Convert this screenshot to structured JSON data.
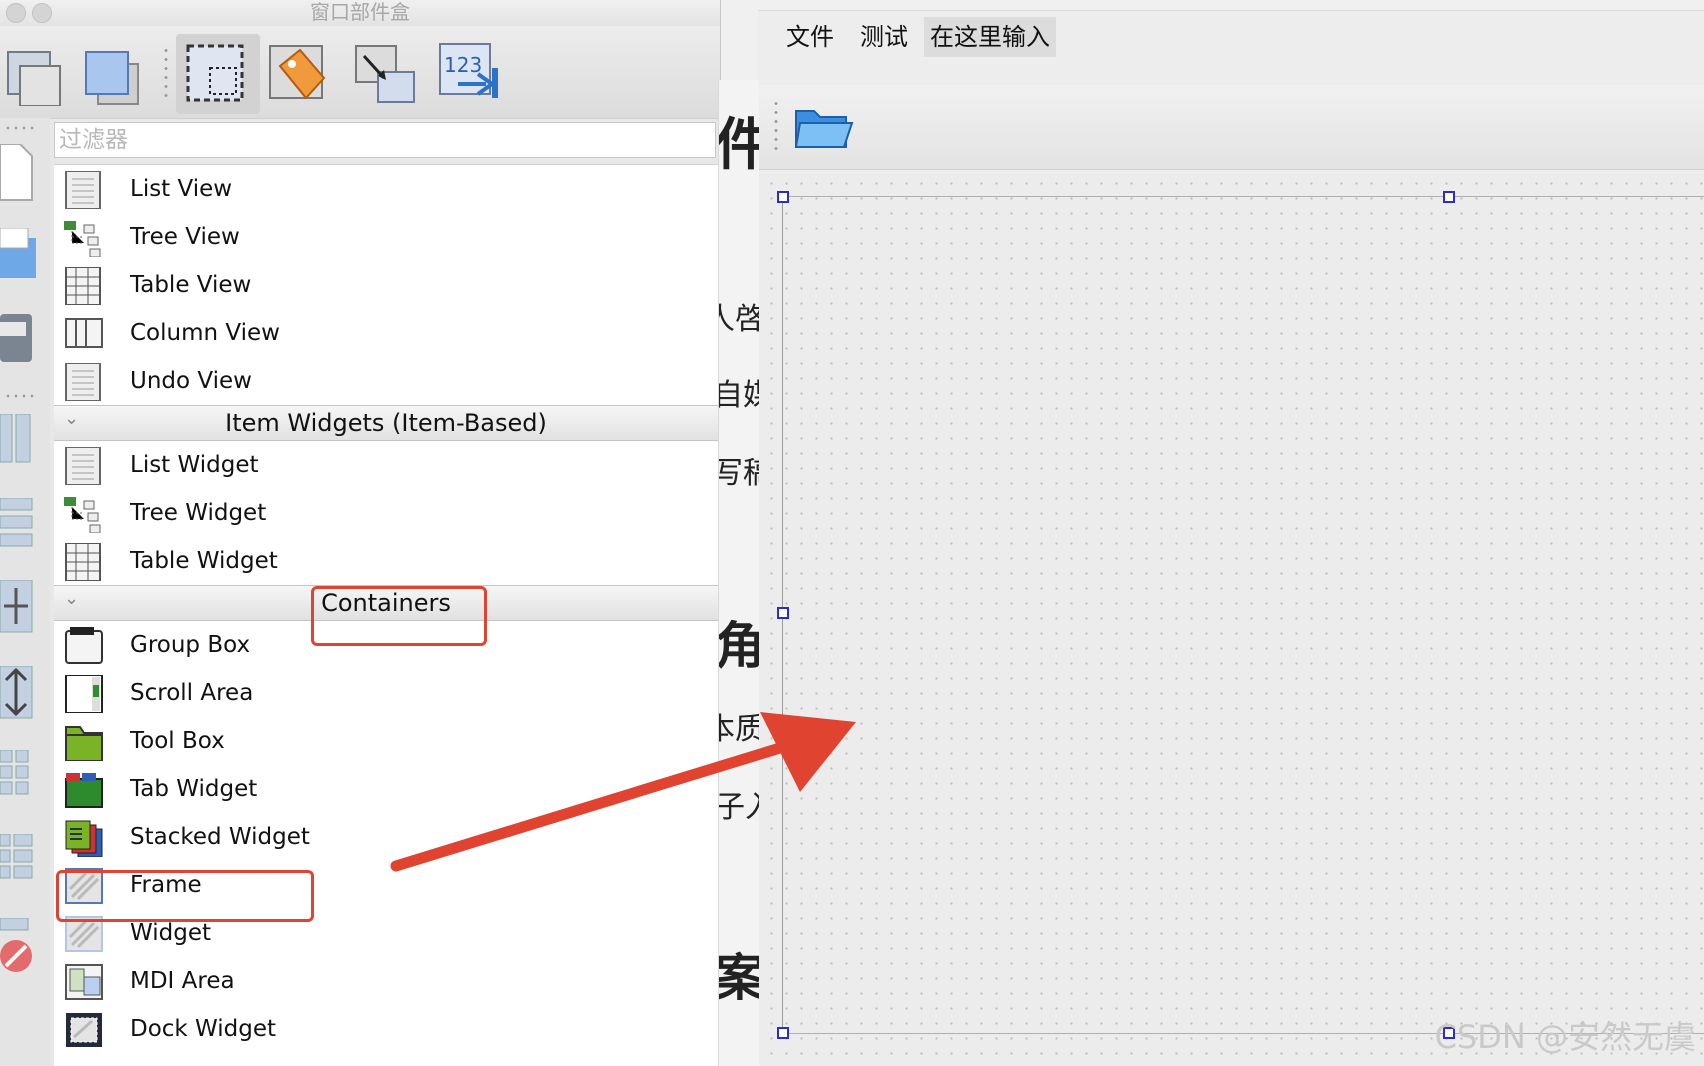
{
  "window": {
    "title": "窗口部件盒"
  },
  "filter": {
    "placeholder": "过滤器"
  },
  "top_views": [
    "List View",
    "Tree View",
    "Table View",
    "Column View",
    "Undo View"
  ],
  "categories": {
    "item_widgets": "Item Widgets (Item-Based)",
    "containers": "Containers"
  },
  "item_widgets": [
    "List Widget",
    "Tree Widget",
    "Table Widget"
  ],
  "containers": [
    "Group Box",
    "Scroll Area",
    "Tool Box",
    "Tab Widget",
    "Stacked Widget",
    "Frame",
    "Widget",
    "MDI Area",
    "Dock Widget"
  ],
  "form": {
    "menu": [
      "文件",
      "测试",
      "在这里输入"
    ]
  },
  "background_peek": [
    "件",
    "人啓",
    "自媒",
    "写稿",
    "角",
    "本质",
    "子入",
    "案"
  ],
  "watermark": "CSDN @安然无虞",
  "colors": {
    "highlight": "#e0432f",
    "selection_handle": "#2b2bd6"
  }
}
